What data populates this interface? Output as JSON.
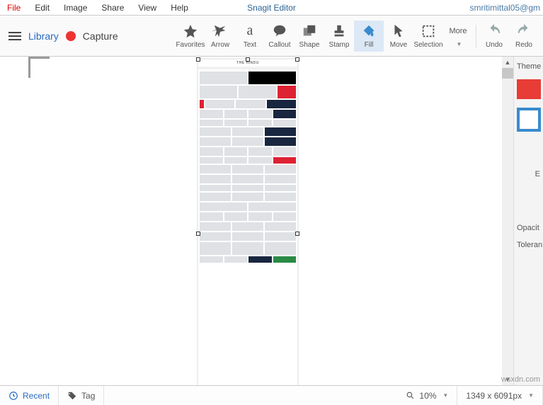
{
  "menubar": {
    "items": [
      "File",
      "Edit",
      "Image",
      "Share",
      "View",
      "Help"
    ],
    "title": "Snagit Editor",
    "user": "smritimittal05@gm"
  },
  "leftControls": {
    "library": "Library",
    "capture": "Capture"
  },
  "tools": [
    {
      "name": "favorites",
      "label": "Favorites"
    },
    {
      "name": "arrow",
      "label": "Arrow"
    },
    {
      "name": "text",
      "label": "Text"
    },
    {
      "name": "callout",
      "label": "Callout"
    },
    {
      "name": "shape",
      "label": "Shape"
    },
    {
      "name": "stamp",
      "label": "Stamp"
    },
    {
      "name": "fill",
      "label": "Fill",
      "active": true
    },
    {
      "name": "move",
      "label": "Move"
    },
    {
      "name": "selection",
      "label": "Selection"
    },
    {
      "name": "more",
      "label": "More"
    }
  ],
  "history": {
    "undo": "Undo",
    "redo": "Redo"
  },
  "sidePanel": {
    "theme": "Theme",
    "effects_initial": "E",
    "opacity": "Opacit",
    "tolerance": "Toleran"
  },
  "canvas": {
    "page_title": "THE HINDU"
  },
  "statusbar": {
    "recent": "Recent",
    "tag": "Tag",
    "zoom": "10%",
    "dimensions": "1349 x 6091px"
  },
  "watermark": "wsxdn.com"
}
